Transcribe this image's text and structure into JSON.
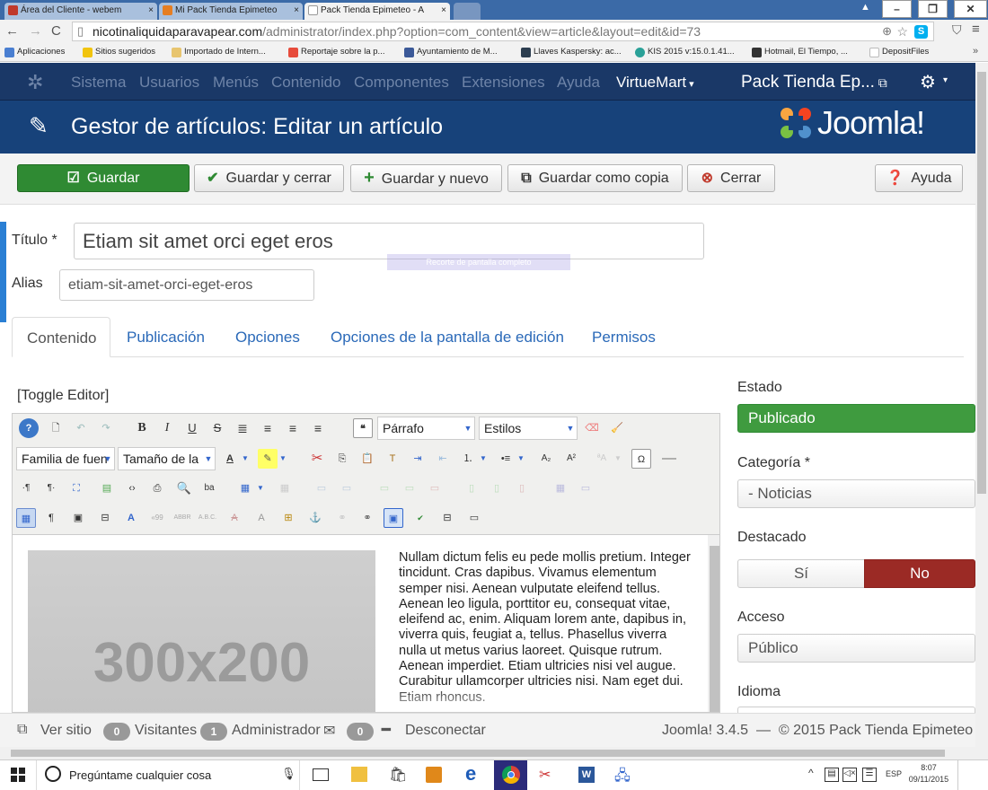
{
  "browser": {
    "tabs": [
      {
        "label": "Área del Cliente - webem",
        "color": "#c0392b"
      },
      {
        "label": "Mi Pack Tienda Epimeteo",
        "color": "#e67e22"
      },
      {
        "label": "Pack Tienda Epimeteo - A",
        "color": "#ffffff"
      }
    ],
    "url_host": "nicotinaliquidaparavapear.com",
    "url_path": "/administrator/index.php?option=com_content&view=article&layout=edit&id=73",
    "bookmarks": [
      {
        "label": "Aplicaciones",
        "color": "#4a7fd1"
      },
      {
        "label": "Sitios sugeridos",
        "color": "#f1c40f"
      },
      {
        "label": "Importado de Intern...",
        "color": "#e8c56f"
      },
      {
        "label": "Reportaje sobre la p...",
        "color": "#e74c3c"
      },
      {
        "label": "Ayuntamiento de M...",
        "color": "#3b5998"
      },
      {
        "label": "Llaves Kaspersky: ac...",
        "color": "#2c3e50"
      },
      {
        "label": "KIS 2015 v:15.0.1.41...",
        "color": "#2aa198"
      },
      {
        "label": "Hotmail, El Tiempo, ...",
        "color": "#333333"
      },
      {
        "label": "DepositFiles",
        "color": "#bbbbbb"
      }
    ]
  },
  "joomla": {
    "menu": [
      "Sistema",
      "Usuarios",
      "Menús",
      "Contenido",
      "Componentes",
      "Extensiones",
      "Ayuda"
    ],
    "menu_active": "VirtueMart",
    "site_name": "Pack Tienda Ep...",
    "page_title": "Gestor de artículos: Editar un artículo",
    "logo_text": "Joomla!"
  },
  "toolbar": {
    "save": "Guardar",
    "save_close": "Guardar y cerrar",
    "save_new": "Guardar y nuevo",
    "save_copy": "Guardar como copia",
    "close": "Cerrar",
    "help": "Ayuda"
  },
  "form": {
    "title_label": "Título *",
    "title_value": "Etiam sit amet orci eget eros",
    "alias_label": "Alias",
    "alias_value": "etiam-sit-amet-orci-eget-eros",
    "overlay_text": "Recorte de pantalla completo"
  },
  "tabs": [
    "Contenido",
    "Publicación",
    "Opciones",
    "Opciones de la pantalla de edición",
    "Permisos"
  ],
  "editor": {
    "toggle": "[Toggle Editor]",
    "format_select": "Párrafo",
    "styles_select": "Estilos",
    "font_family": "Familia de fuen",
    "font_size": "Tamaño de la",
    "image_label": "300x200",
    "body_text": "Nullam dictum felis eu pede mollis pretium. Integer tincidunt. Cras dapibus. Vivamus elementum semper nisi. Aenean vulputate eleifend tellus. Aenean leo ligula, porttitor eu, consequat vitae, eleifend ac, enim. Aliquam lorem ante, dapibus in, viverra quis, feugiat a, tellus. Phasellus viverra nulla ut metus varius laoreet. Quisque rutrum. Aenean imperdiet. Etiam ultricies nisi vel augue. Curabitur ullamcorper ultricies nisi. Nam eget dui. Etiam rhoncus."
  },
  "sidebar": {
    "estado_label": "Estado",
    "estado_value": "Publicado",
    "categoria_label": "Categoría *",
    "categoria_value": "- Noticias",
    "destacado_label": "Destacado",
    "si": "Sí",
    "no": "No",
    "acceso_label": "Acceso",
    "acceso_value": "Público",
    "idioma_label": "Idioma"
  },
  "status": {
    "view_site": "Ver sitio",
    "visitors_count": "0",
    "visitors": "Visitantes",
    "admin_count": "1",
    "admin": "Administrador",
    "messages_count": "0",
    "logout": "Desconectar",
    "version": "Joomla! 3.4.5  —  © 2015 Pack Tienda Epimeteo"
  },
  "taskbar": {
    "search": "Pregúntame cualquier cosa",
    "lang": "ESP",
    "time": "8:07",
    "date": "09/11/2015"
  },
  "colors": {
    "nav": "#1a3867",
    "header": "#17427a",
    "save_green": "#2f8a33",
    "no_red": "#9b2a25"
  }
}
